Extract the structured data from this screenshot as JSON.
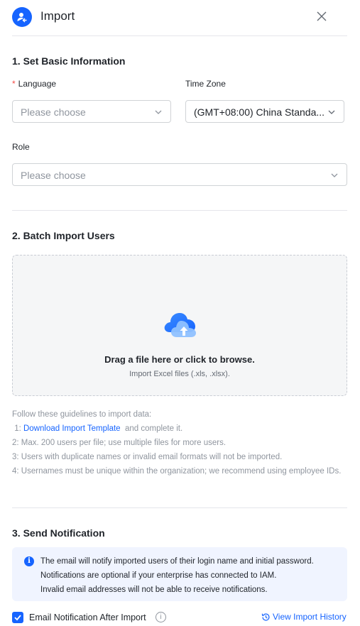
{
  "header": {
    "title": "Import",
    "icon": "user-import-icon",
    "accent": "#1664ff"
  },
  "section1": {
    "title": "1. Set Basic Information",
    "language": {
      "label": "Language",
      "required_mark": "*",
      "placeholder": "Please choose"
    },
    "timezone": {
      "label": "Time Zone",
      "value": "(GMT+08:00) China Standa..."
    },
    "role": {
      "label": "Role",
      "placeholder": "Please choose"
    }
  },
  "section2": {
    "title": "2. Batch Import Users",
    "upload": {
      "main": "Drag a file here or click to browse.",
      "sub": "Import Excel files (.xls, .xlsx)."
    },
    "guides": {
      "intro": "Follow these guidelines to import data:",
      "item1_prefix": " 1: ",
      "item1_link": "Download Import Template",
      "item1_suffix": "  and complete it.",
      "item2": " 2: Max. 200 users per file; use multiple files for more users.",
      "item3": " 3: Users with duplicate names or invalid email formats will not be imported.",
      "item4": " 4: Usernames must be unique within the organization; we recommend using employee IDs."
    }
  },
  "section3": {
    "title": "3. Send Notification",
    "notice": {
      "line1": "The email will notify imported users of their login name and initial password.",
      "line2": "Notifications are optional if your enterprise has connected to IAM.",
      "line3": "Invalid email addresses will not be able to receive notifications."
    },
    "checkbox_label": "Email Notification After Import",
    "checked": true,
    "history_link": "View Import History"
  }
}
